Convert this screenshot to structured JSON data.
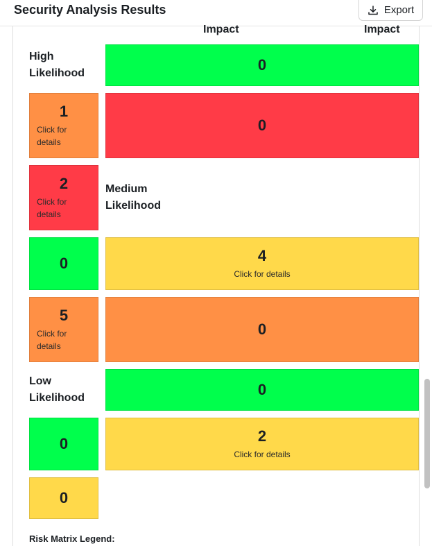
{
  "header": {
    "title": "Security Analysis Results",
    "export_label": "Export",
    "export_icon": "download-icon"
  },
  "matrix": {
    "col_headers": [
      "Impact",
      "Impact"
    ],
    "rows": {
      "high": "High\nLikelihood",
      "medium": "Medium\nLikelihood",
      "low": "Low\nLikelihood"
    },
    "click_hint_wide": "Click for details",
    "click_hint_small": "Click for\ndetails",
    "cells": {
      "high_wide": "0",
      "high_small_1": "1",
      "high_wide_2": "0",
      "high_small_2": "2",
      "med_small_1": "0",
      "med_wide_1": "4",
      "med_small_2": "5",
      "med_wide_2": "0",
      "low_wide_1": "0",
      "low_small_1": "0",
      "low_wide_2": "2",
      "low_small_2": "0"
    },
    "colors": {
      "green": "#00ff4c",
      "red": "#ff3b47",
      "orange": "#ff9045",
      "yellow": "#ffd94a"
    }
  },
  "legend": {
    "title": "Risk Matrix Legend:"
  }
}
